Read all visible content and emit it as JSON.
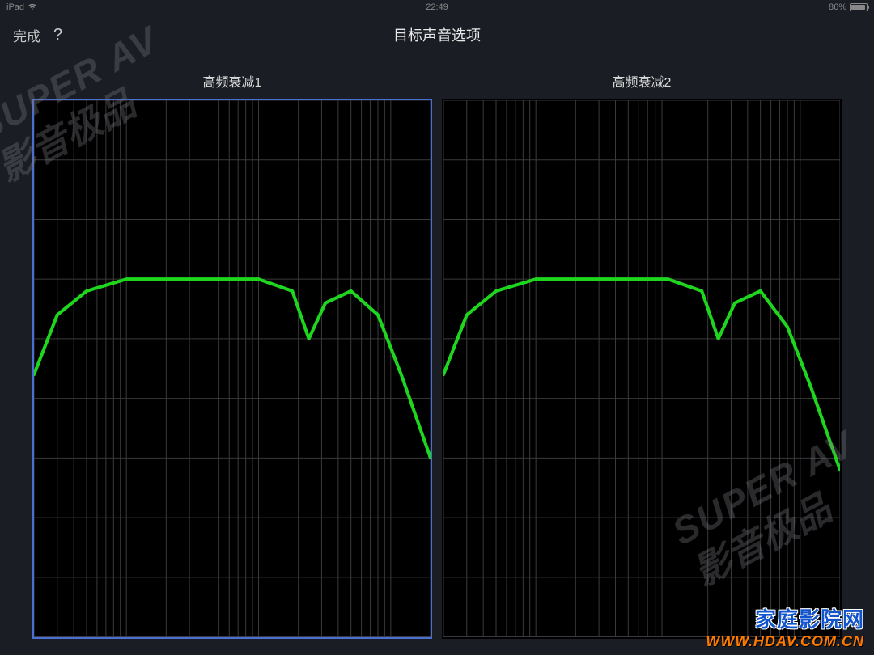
{
  "status_bar": {
    "device": "iPad",
    "wifi": "wifi-icon",
    "time": "22:49",
    "battery_percent": "86%"
  },
  "nav": {
    "done_label": "完成",
    "help_label": "?",
    "title": "目标声音选项"
  },
  "options": [
    {
      "label": "高频衰减1",
      "selected": true
    },
    {
      "label": "高频衰减2",
      "selected": false
    }
  ],
  "watermarks": {
    "brand_en": "SUPER AV",
    "brand_cn": "影音极品",
    "site_title": "家庭影院网",
    "site_url": "WWW.HDAV.COM.CN"
  },
  "chart_data": [
    {
      "type": "line",
      "title": "高频衰减1",
      "x_scale": "log",
      "axis_labels_visible": false,
      "grid": true,
      "line_color": "#1fd61f",
      "points": [
        {
          "x": 20,
          "y": -8
        },
        {
          "x": 30,
          "y": -3
        },
        {
          "x": 50,
          "y": -1
        },
        {
          "x": 100,
          "y": 0
        },
        {
          "x": 300,
          "y": 0
        },
        {
          "x": 1000,
          "y": 0
        },
        {
          "x": 1800,
          "y": -1
        },
        {
          "x": 2400,
          "y": -5
        },
        {
          "x": 3200,
          "y": -2
        },
        {
          "x": 5000,
          "y": -1
        },
        {
          "x": 8000,
          "y": -3
        },
        {
          "x": 12000,
          "y": -8
        },
        {
          "x": 20000,
          "y": -15
        }
      ],
      "x_range": [
        20,
        20000
      ],
      "y_range": [
        -30,
        15
      ]
    },
    {
      "type": "line",
      "title": "高频衰减2",
      "x_scale": "log",
      "axis_labels_visible": false,
      "grid": true,
      "line_color": "#1fd61f",
      "points": [
        {
          "x": 20,
          "y": -8
        },
        {
          "x": 30,
          "y": -3
        },
        {
          "x": 50,
          "y": -1
        },
        {
          "x": 100,
          "y": 0
        },
        {
          "x": 300,
          "y": 0
        },
        {
          "x": 1000,
          "y": 0
        },
        {
          "x": 1800,
          "y": -1
        },
        {
          "x": 2400,
          "y": -5
        },
        {
          "x": 3200,
          "y": -2
        },
        {
          "x": 5000,
          "y": -1
        },
        {
          "x": 8000,
          "y": -4
        },
        {
          "x": 12000,
          "y": -9
        },
        {
          "x": 20000,
          "y": -16
        }
      ],
      "x_range": [
        20,
        20000
      ],
      "y_range": [
        -30,
        15
      ]
    }
  ]
}
